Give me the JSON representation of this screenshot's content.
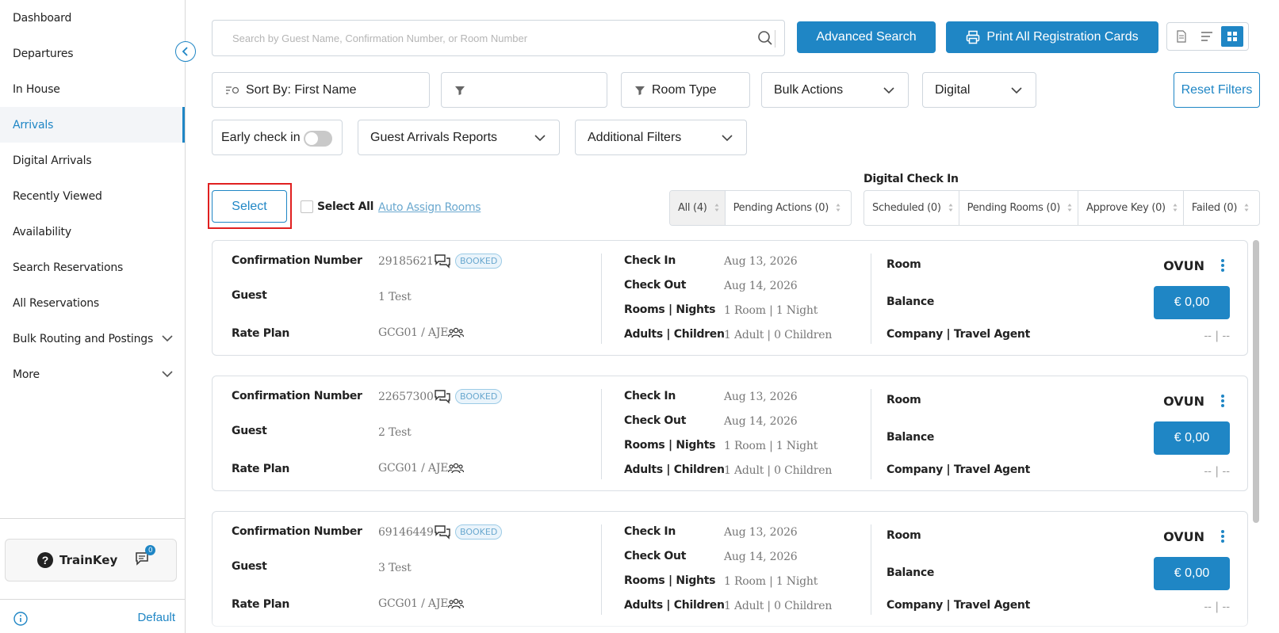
{
  "sidebar": {
    "items": [
      {
        "label": "Dashboard"
      },
      {
        "label": "Departures"
      },
      {
        "label": "In House"
      },
      {
        "label": "Arrivals",
        "active": true
      },
      {
        "label": "Digital Arrivals"
      },
      {
        "label": "Recently Viewed"
      },
      {
        "label": "Availability"
      },
      {
        "label": "Search Reservations"
      },
      {
        "label": "All Reservations"
      },
      {
        "label": "Bulk Routing and Postings",
        "expandable": true
      },
      {
        "label": "More",
        "expandable": true
      }
    ],
    "trainkey_label": "TrainKey",
    "chat_count": "0",
    "footer_label": "Default"
  },
  "toolbar": {
    "search_placeholder": "Search by Guest Name, Confirmation Number, or Room Number",
    "advanced_search_label": "Advanced Search",
    "print_label": "Print All Registration Cards"
  },
  "filters": {
    "sort_by_label": "Sort By: First Name",
    "filter_value": "",
    "room_type_label": "Room Type",
    "bulk_actions_label": "Bulk Actions",
    "digital_label": "Digital",
    "reset_label": "Reset Filters",
    "early_checkin_label": "Early check in",
    "reports_label": "Guest Arrivals Reports",
    "additional_filters_label": "Additional Filters"
  },
  "actions": {
    "select_label": "Select",
    "select_all_label": "Select All",
    "auto_assign_label": "Auto Assign Rooms"
  },
  "tabs": {
    "all_label": "All (4)",
    "pending_actions_label": "Pending Actions (0)",
    "digital_checkin_title": "Digital Check In",
    "scheduled_label": "Scheduled (0)",
    "pending_rooms_label": "Pending Rooms (0)",
    "approve_key_label": "Approve Key (0)",
    "failed_label": "Failed (0)"
  },
  "labels": {
    "confirmation_number": "Confirmation Number",
    "guest": "Guest",
    "rate_plan": "Rate Plan",
    "check_in": "Check In",
    "check_out": "Check Out",
    "rooms_nights": "Rooms | Nights",
    "adults_children": "Adults | Children",
    "room": "Room",
    "balance": "Balance",
    "company_travel_agent": "Company | Travel Agent"
  },
  "reservations": [
    {
      "confirmation": "29185621",
      "status": "BOOKED",
      "guest": "1 Test",
      "rate_plan": "GCG01 / AJE",
      "check_in": "Aug 13, 2026",
      "check_out": "Aug 14, 2026",
      "rooms_nights": "1 Room | 1 Night",
      "adults_children": "1 Adult | 0 Children",
      "room": "OVUN",
      "balance": "€ 0,00",
      "company": "-- | --"
    },
    {
      "confirmation": "22657300",
      "status": "BOOKED",
      "guest": "2 Test",
      "rate_plan": "GCG01 / AJE",
      "check_in": "Aug 13, 2026",
      "check_out": "Aug 14, 2026",
      "rooms_nights": "1 Room | 1 Night",
      "adults_children": "1 Adult | 0 Children",
      "room": "OVUN",
      "balance": "€ 0,00",
      "company": "-- | --"
    },
    {
      "confirmation": "69146449",
      "status": "BOOKED",
      "guest": "3 Test",
      "rate_plan": "GCG01 / AJE",
      "check_in": "Aug 13, 2026",
      "check_out": "Aug 14, 2026",
      "rooms_nights": "1 Room | 1 Night",
      "adults_children": "1 Adult | 0 Children",
      "room": "OVUN",
      "balance": "€ 0,00",
      "company": "-- | --"
    }
  ],
  "colors": {
    "accent": "#1f86c5",
    "highlight": "#e02020"
  }
}
